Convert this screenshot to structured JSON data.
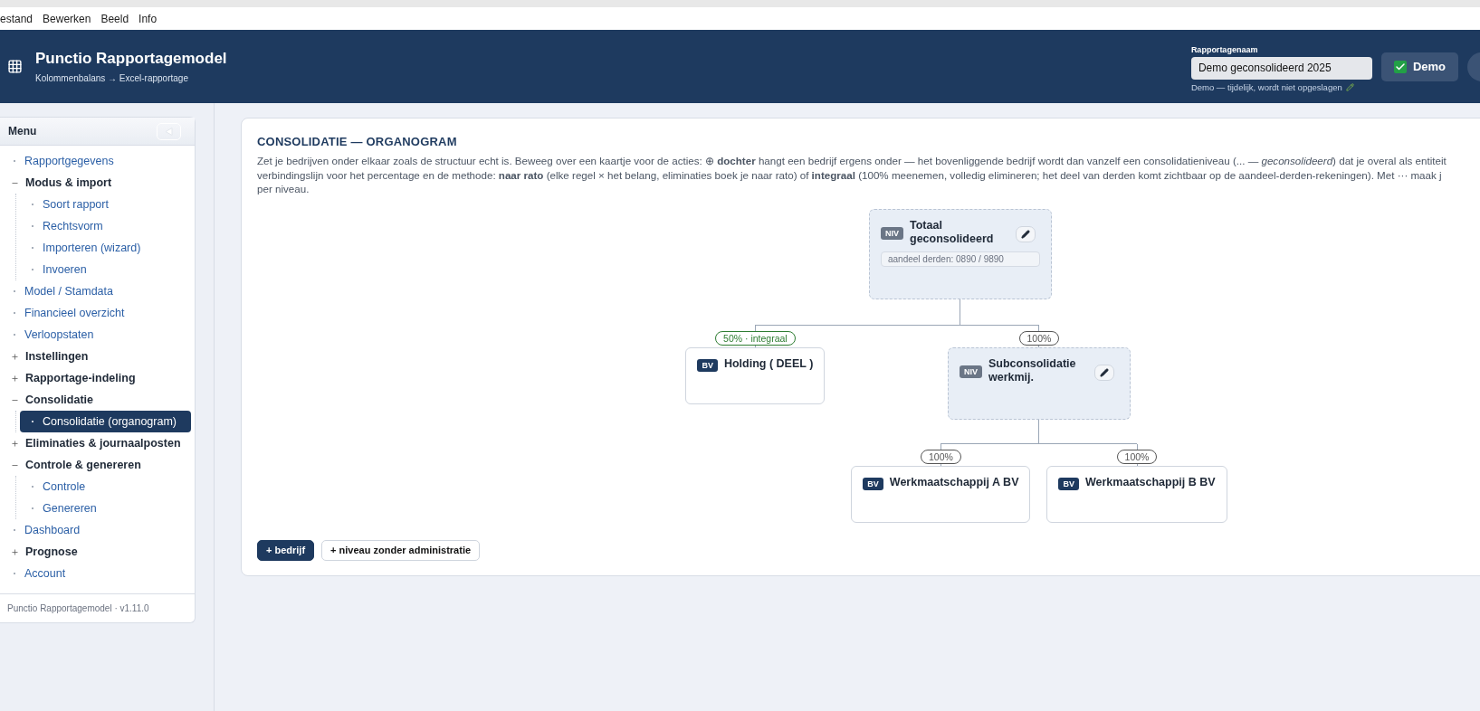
{
  "menubar": [
    "estand",
    "Bewerken",
    "Beeld",
    "Info"
  ],
  "header": {
    "title": "Punctio Rapportagemodel",
    "subtitle": "Kolommenbalans → Excel-rapportage",
    "report_name_label": "Rapportagenaam",
    "report_name_value": "Demo geconsolideerd 2025",
    "note": "Demo — tijdelijk, wordt niet opgeslagen",
    "demo": {
      "label": "Demo",
      "checked": true
    }
  },
  "sidebar": {
    "title": "Menu",
    "items": [
      {
        "kind": "link",
        "label": "Rapportgegevens",
        "selected": false
      },
      {
        "kind": "group",
        "label": "Modus & import",
        "expanded": true,
        "selected": false,
        "children": [
          {
            "kind": "link",
            "label": "Soort rapport",
            "selected": false
          },
          {
            "kind": "link",
            "label": "Rechtsvorm",
            "selected": false
          },
          {
            "kind": "link",
            "label": "Importeren (wizard)",
            "selected": false
          },
          {
            "kind": "link",
            "label": "Invoeren",
            "selected": false
          }
        ]
      },
      {
        "kind": "link",
        "label": "Model / Stamdata",
        "selected": false
      },
      {
        "kind": "link",
        "label": "Financieel overzicht",
        "selected": false
      },
      {
        "kind": "link",
        "label": "Verloopstaten",
        "selected": false
      },
      {
        "kind": "group",
        "label": "Instellingen",
        "expanded": false,
        "selected": false
      },
      {
        "kind": "group",
        "label": "Rapportage-indeling",
        "expanded": false,
        "selected": false
      },
      {
        "kind": "group",
        "label": "Consolidatie",
        "expanded": true,
        "selected": false,
        "children": [
          {
            "kind": "link",
            "label": "Consolidatie (organogram)",
            "selected": true
          }
        ]
      },
      {
        "kind": "group",
        "label": "Eliminaties & journaalposten",
        "expanded": false,
        "selected": false
      },
      {
        "kind": "group",
        "label": "Controle & genereren",
        "expanded": true,
        "selected": false,
        "children": [
          {
            "kind": "link",
            "label": "Controle",
            "selected": false
          },
          {
            "kind": "link",
            "label": "Genereren",
            "selected": false
          }
        ]
      },
      {
        "kind": "link",
        "label": "Dashboard",
        "selected": false
      },
      {
        "kind": "group",
        "label": "Prognose",
        "expanded": false,
        "selected": false
      },
      {
        "kind": "link",
        "label": "Account",
        "selected": false
      }
    ],
    "footer": "Punctio Rapportagemodel · v1.11.0"
  },
  "page": {
    "heading": "CONSOLIDATIE — ORGANOGRAM",
    "description": [
      "Zet je bedrijven onder elkaar zoals de structuur echt is. Beweeg over een kaartje voor de acties: ⊕ **dochter** hangt een bedrijf ergens onder — het bovenliggende bedrijf wordt dan vanzelf een consolidatieniveau (... — *geconsolideerd*) dat je overal als entiteit",
      "verbindingslijn voor het percentage en de methode: **naar rato** (elke regel × het belang, eliminaties boek je naar rato) of **integraal** (100% meenemen, volledig elimineren; het deel van derden komt zichtbaar op de aandeel-derden-rekeningen). Met ··· maak j",
      "per niveau."
    ],
    "organogram": {
      "kind": "level",
      "badge": "NIV",
      "name": "Totaal geconsolideerd",
      "share_field": "aandeel derden: 0890 / 9890",
      "children": [
        {
          "link": {
            "label": "50% · integraal",
            "color": "#2e7d32"
          },
          "kind": "company",
          "badge": "BV",
          "name": "Holding ( DEEL )"
        },
        {
          "link": {
            "label": "100%",
            "color": "#555555"
          },
          "kind": "level",
          "badge": "NIV",
          "name": "Subconsolidatie werkmij.",
          "children": [
            {
              "link": {
                "label": "100%",
                "color": "#555555"
              },
              "kind": "company",
              "badge": "BV",
              "name": "Werkmaatschappij A BV"
            },
            {
              "link": {
                "label": "100%",
                "color": "#555555"
              },
              "kind": "company",
              "badge": "BV",
              "name": "Werkmaatschappij B BV"
            }
          ]
        }
      ]
    },
    "buttons": [
      {
        "kind": "primary",
        "label": "+ bedrijf"
      },
      {
        "kind": "secondary",
        "label": "+ niveau zonder administratie"
      }
    ]
  }
}
